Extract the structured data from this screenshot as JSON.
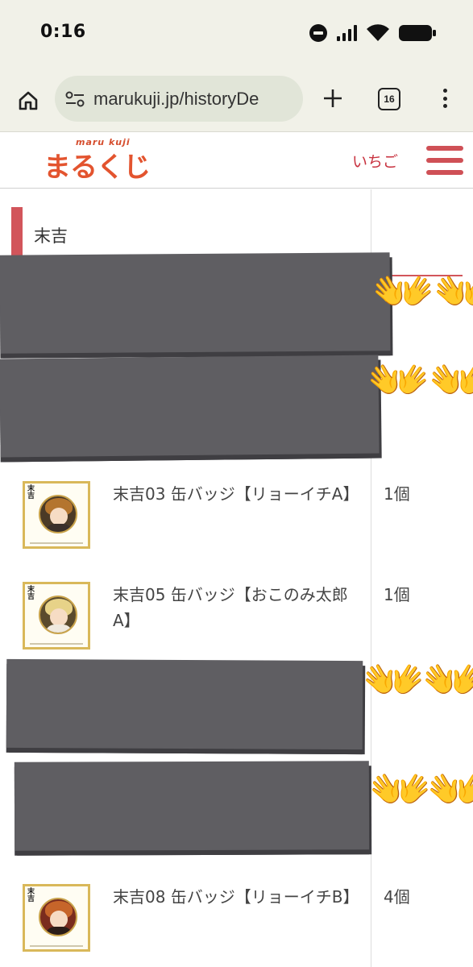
{
  "status_bar": {
    "time": "0:16"
  },
  "browser": {
    "url": "marukuji.jp/historyDe",
    "tab_count": "16"
  },
  "site": {
    "logo_sub": "maru kuji",
    "logo_main": "まるくじ",
    "user_name": "いちご"
  },
  "section": {
    "title": "末吉"
  },
  "items": [
    {
      "name": "末吉03 缶バッジ【リョーイチA】",
      "qty": "1個",
      "tag": "末吉",
      "hair_color": "#b4752e"
    },
    {
      "name": "末吉05 缶バッジ【おこのみ太郎A】",
      "qty": "1個",
      "tag": "末吉",
      "hair_color": "#e7d288"
    },
    {
      "name": "末吉08 缶バッジ【リョーイチB】",
      "qty": "4個",
      "tag": "末吉",
      "hair_color": "#c6652a"
    }
  ],
  "redaction_emoji": "👐",
  "colors": {
    "accent_red": "#d2555b",
    "logo_orange": "#e3542f",
    "redaction_gray": "#5f5e62",
    "thumb_border": "#d9b85a"
  }
}
